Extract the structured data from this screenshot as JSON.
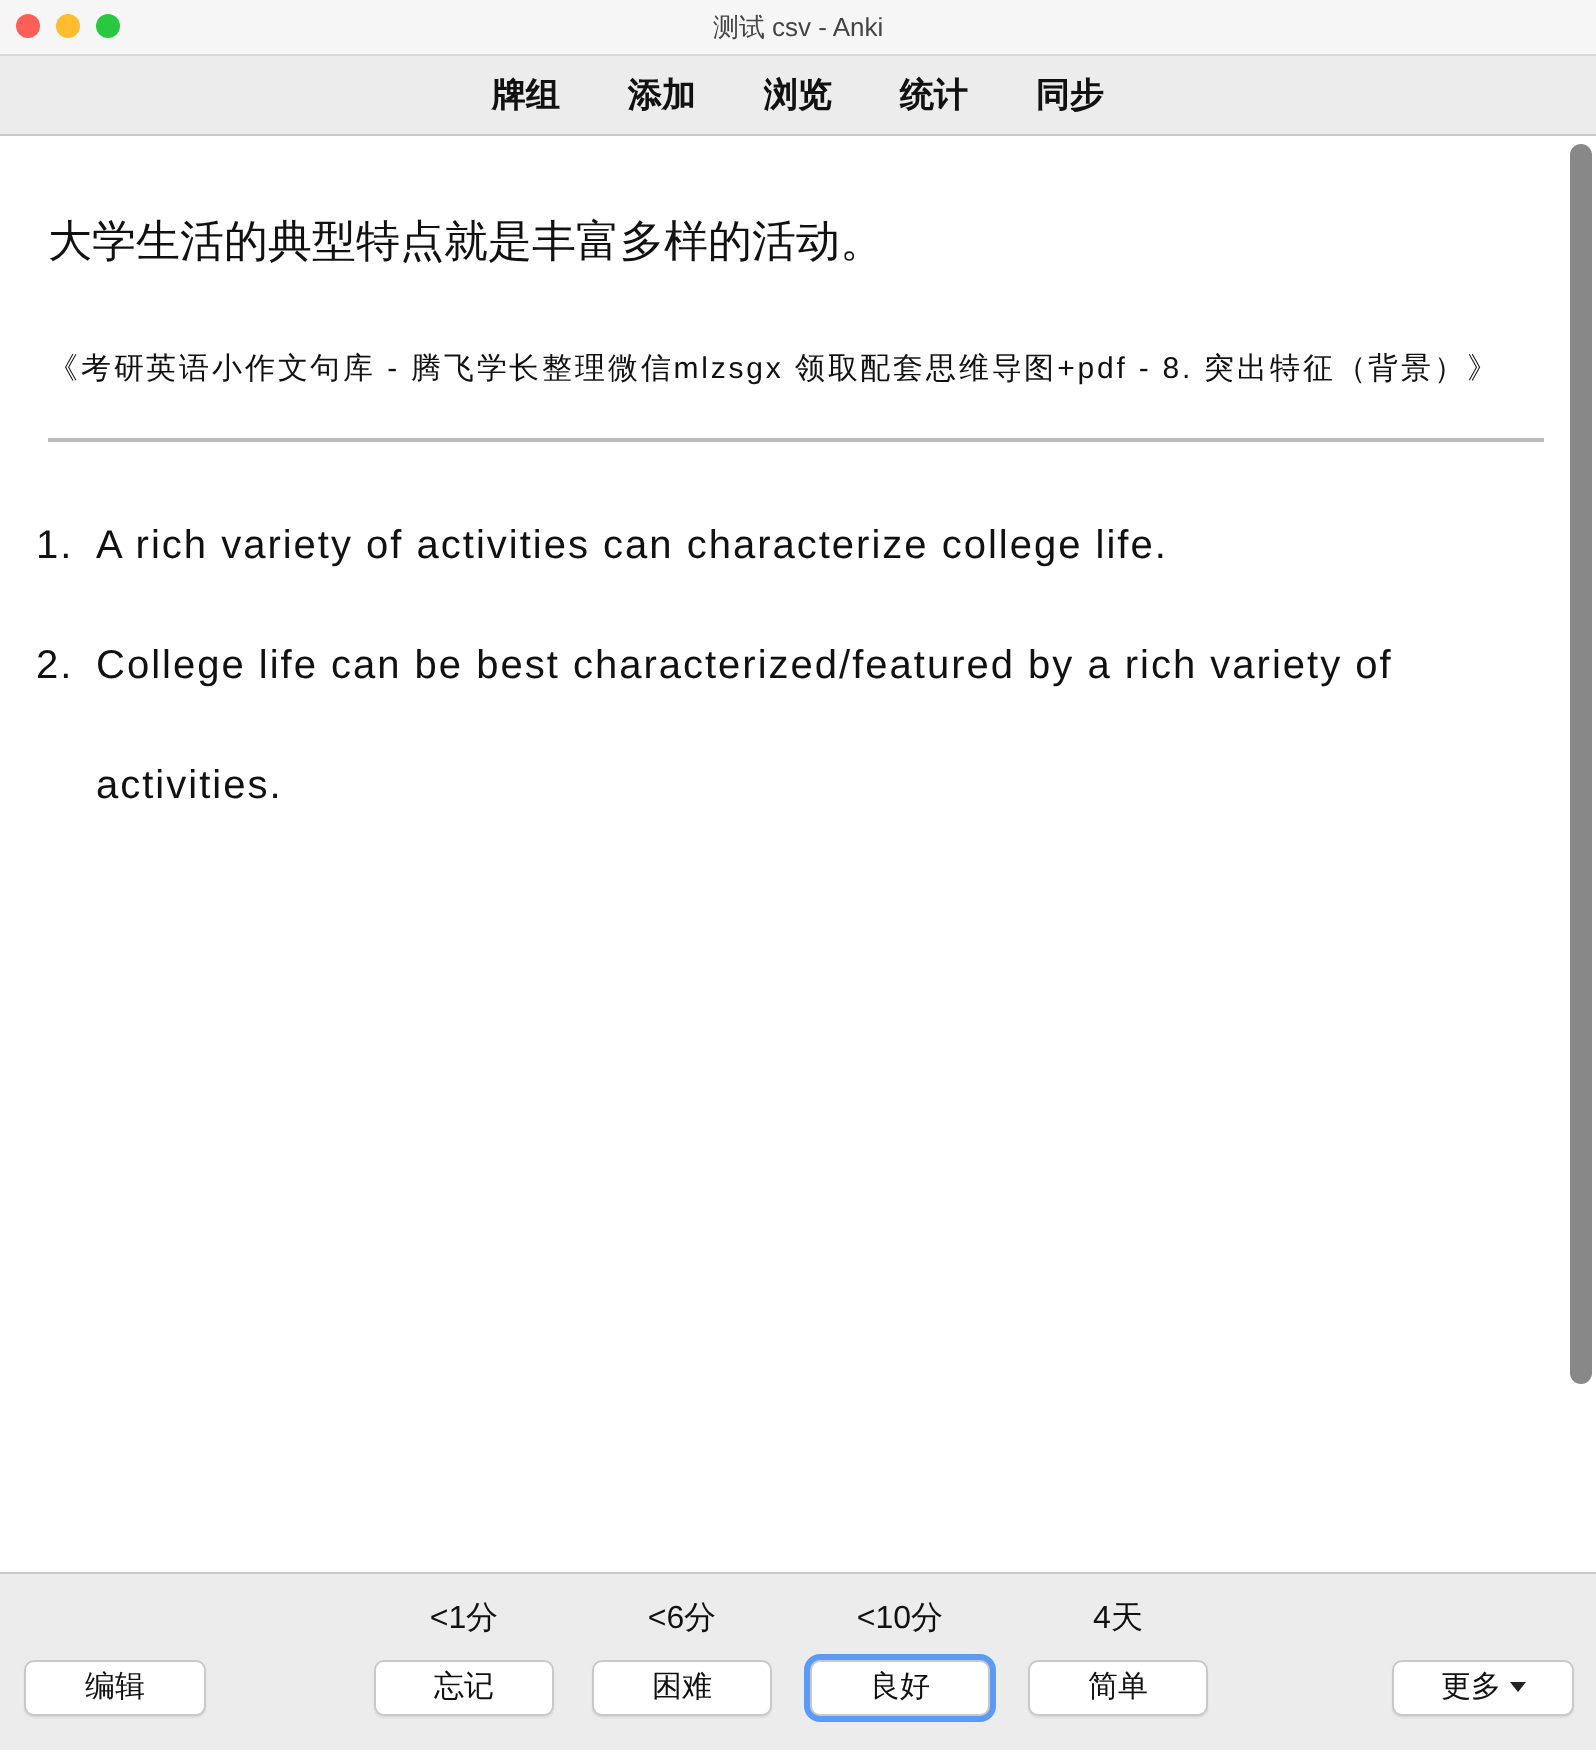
{
  "window": {
    "title": "测试 csv - Anki"
  },
  "toolbar": [
    {
      "label": "牌组"
    },
    {
      "label": "添加"
    },
    {
      "label": "浏览"
    },
    {
      "label": "统计"
    },
    {
      "label": "同步"
    }
  ],
  "card": {
    "question": "大学生活的典型特点就是丰富多样的活动。",
    "source": "《考研英语小作文句库 - 腾飞学长整理微信mlzsgx 领取配套思维导图+pdf - 8. 突出特征（背景）》",
    "answers": [
      {
        "marker": "1.",
        "text": "A rich variety of activities can characterize college life."
      },
      {
        "marker": "2.",
        "text": "College life can be best characterized/featured by a rich variety of activities."
      }
    ]
  },
  "bottom_bar": {
    "edit_button": "编辑",
    "answer_buttons": [
      {
        "interval": "<1分",
        "label": "忘记",
        "selected": false
      },
      {
        "interval": "<6分",
        "label": "困难",
        "selected": false
      },
      {
        "interval": "<10分",
        "label": "良好",
        "selected": true
      },
      {
        "interval": "4天",
        "label": "简单",
        "selected": false
      }
    ],
    "more_button": "更多"
  }
}
